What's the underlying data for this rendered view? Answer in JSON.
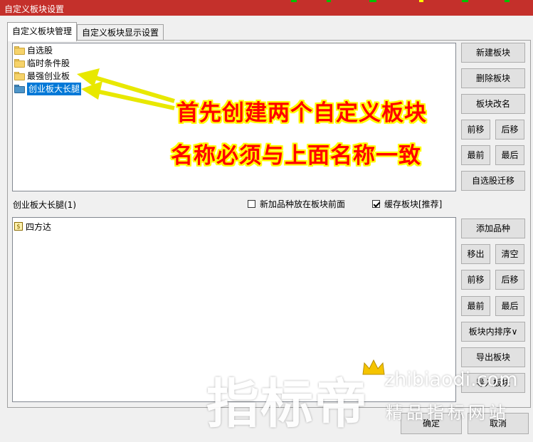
{
  "window": {
    "title": "自定义板块设置"
  },
  "tabs": [
    {
      "label": "自定义板块管理",
      "active": true
    },
    {
      "label": "自定义板块显示设置",
      "active": false
    }
  ],
  "block_list": {
    "items": [
      {
        "label": "自选股",
        "selected": false
      },
      {
        "label": "临时条件股",
        "selected": false
      },
      {
        "label": "最强创业板",
        "selected": false
      },
      {
        "label": "创业板大长腿",
        "selected": true
      }
    ]
  },
  "block_buttons": {
    "new": "新建板块",
    "delete": "删除板块",
    "rename": "板块改名",
    "move_up": "前移",
    "move_down": "后移",
    "move_first": "最前",
    "move_last": "最后",
    "migrate": "自选股迁移"
  },
  "selected_block_label": "创业板大长腿(1)",
  "options": {
    "new_items_front": {
      "label": "新加品种放在板块前面",
      "checked": false
    },
    "cache_block": {
      "label": "缓存板块[推荐]",
      "checked": true
    }
  },
  "stock_list": {
    "items": [
      {
        "label": "四方达",
        "icon": "$"
      }
    ]
  },
  "stock_buttons": {
    "add": "添加品种",
    "remove": "移出",
    "clear": "清空",
    "move_up": "前移",
    "move_down": "后移",
    "move_first": "最前",
    "move_last": "最后",
    "sort": "板块内排序∨",
    "export": "导出板块",
    "import": "导入板块"
  },
  "dialog_buttons": {
    "ok": "确定",
    "cancel": "取消"
  },
  "annotations": {
    "line1": "首先创建两个自定义板块",
    "line2": "名称必须与上面名称一致"
  },
  "watermark": {
    "brand": "指标帝",
    "url": "zhibiaodi.com",
    "slogan": "精品指标网站"
  },
  "colors": {
    "titlebar": "#c4302b",
    "selection": "#0078d7",
    "annotation_text": "#ff0000",
    "annotation_outline": "#ffff00"
  }
}
